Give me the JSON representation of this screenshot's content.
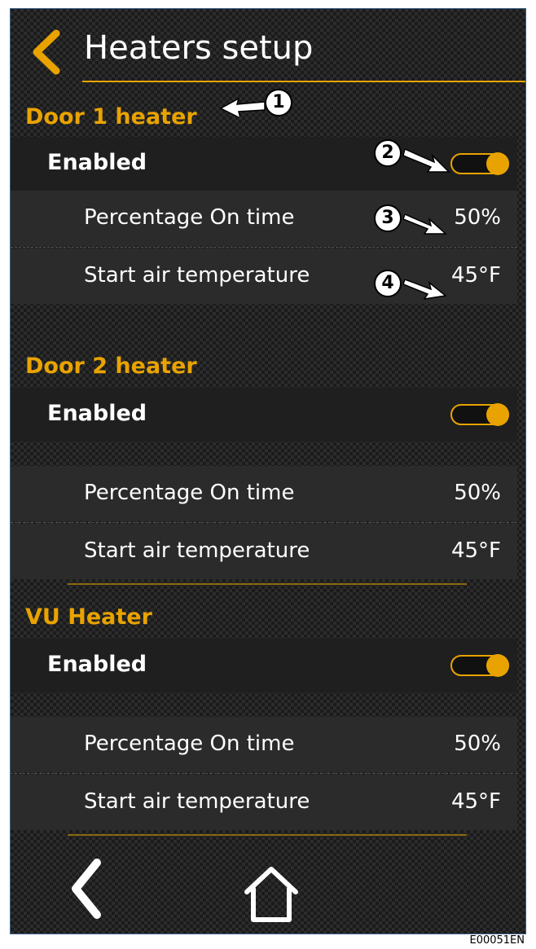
{
  "header": {
    "title": "Heaters setup"
  },
  "sections": [
    {
      "title": "Door 1 heater",
      "enabled_label": "Enabled",
      "enabled": true,
      "rows": [
        {
          "label": "Percentage On time",
          "value": "50%"
        },
        {
          "label": "Start air temperature",
          "value": "45°F"
        }
      ]
    },
    {
      "title": "Door 2 heater",
      "enabled_label": "Enabled",
      "enabled": true,
      "rows": [
        {
          "label": "Percentage On time",
          "value": "50%"
        },
        {
          "label": "Start air temperature",
          "value": "45°F"
        }
      ]
    },
    {
      "title": "VU Heater",
      "enabled_label": "Enabled",
      "enabled": true,
      "rows": [
        {
          "label": "Percentage On time",
          "value": "50%"
        },
        {
          "label": "Start air temperature",
          "value": "45°F"
        }
      ]
    }
  ],
  "callouts": [
    "1",
    "2",
    "3",
    "4"
  ],
  "figure_code": "E00051EN",
  "colors": {
    "accent": "#e9a300",
    "background": "#1b1b1b"
  },
  "icons": {
    "back": "chevron-left-icon",
    "home": "home-icon"
  }
}
